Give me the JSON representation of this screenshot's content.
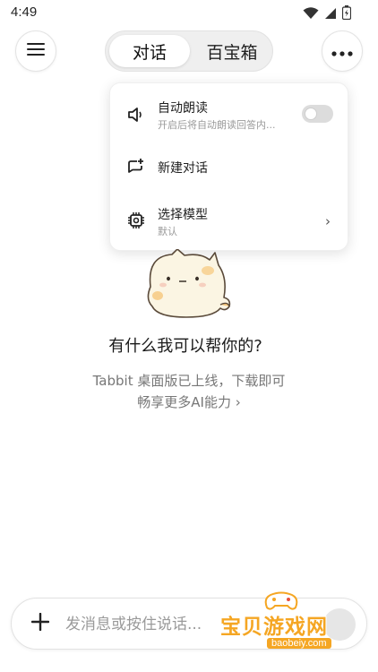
{
  "status_bar": {
    "time": "4:49"
  },
  "header": {
    "tabs": [
      {
        "label": "对话",
        "active": true
      },
      {
        "label": "百宝箱",
        "active": false
      }
    ]
  },
  "menu": {
    "items": [
      {
        "icon": "speaker-icon",
        "title": "自动朗读",
        "subtitle": "开启后将自动朗读回答内...",
        "toggle_on": false
      },
      {
        "icon": "new-chat-icon",
        "title": "新建对话"
      },
      {
        "icon": "chip-icon",
        "title": "选择模型",
        "subtitle": "默认",
        "chevron": "›"
      }
    ]
  },
  "main": {
    "greeting": "有什么我可以帮你的?",
    "promo_line1": "Tabbit 桌面版已上线，下载即可",
    "promo_line2": "畅享更多AI能力 ›"
  },
  "composer": {
    "placeholder": "发消息或按住说话..."
  },
  "watermark": {
    "text": "宝贝游戏网",
    "url": "baobeiy.com"
  },
  "colors": {
    "accent": "#f5a623",
    "toggle_off": "#dcdcdc",
    "muted_text": "#777777"
  }
}
